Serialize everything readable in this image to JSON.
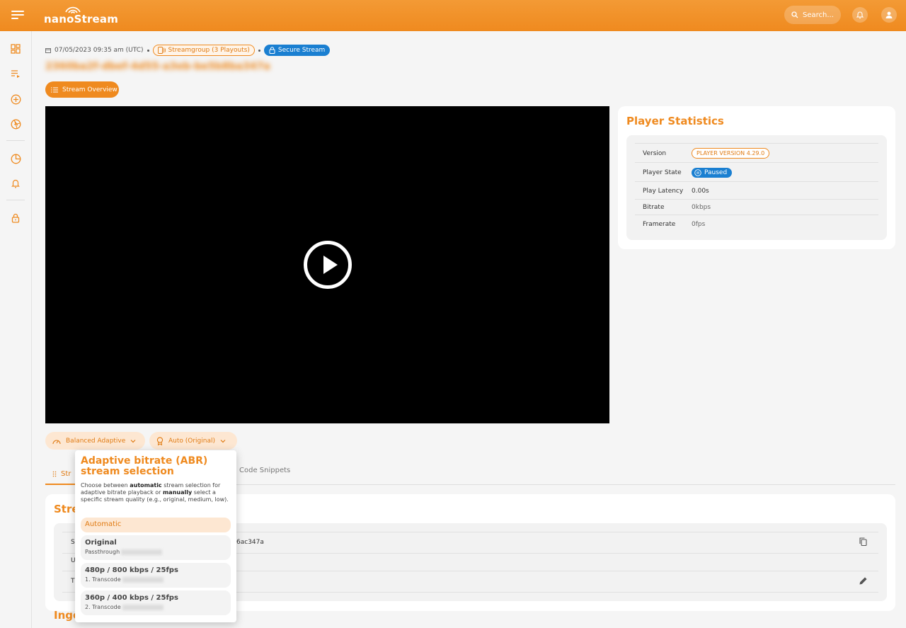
{
  "topbar": {
    "brand": "nanoStream",
    "search_label": "Search..."
  },
  "meta": {
    "date": "07/05/2023 09:35 am (UTC)",
    "streamgroup": "Streamgroup (3 Playouts)",
    "secure": "Secure Stream",
    "stream_id": "2360ba2f-dbef-4d55-a3eb-be5b8ba347a"
  },
  "overview_button": "Stream Overview",
  "player_stats": {
    "title": "Player Statistics",
    "rows": [
      {
        "key": "Version",
        "value": "PLAYER VERSION 4.29.0"
      },
      {
        "key": "Player State",
        "value": "Paused"
      },
      {
        "key": "Play Latency",
        "value": "0.00s"
      },
      {
        "key": "Bitrate",
        "value": "0kbps"
      },
      {
        "key": "Framerate",
        "value": "0fps"
      }
    ]
  },
  "selectors": {
    "mode": "Balanced Adaptive",
    "quality": "Auto (Original)"
  },
  "tabs": {
    "active": "Str",
    "code": "Code Snippets"
  },
  "info": {
    "title": "Stre",
    "row_keys": [
      "S",
      "U",
      "T"
    ],
    "stream_value": "6ac347a",
    "ingest_title": "Inge"
  },
  "popup": {
    "title": "Adaptive bitrate (ABR) stream selection",
    "desc_1": "Choose between ",
    "desc_auto": "automatic",
    "desc_2": " stream selection for adaptive bitrate playback or ",
    "desc_manual": "manually",
    "desc_3": " select a specific stream quality (e.g., original, medium, low).",
    "options": [
      {
        "label": "Automatic"
      },
      {
        "label": "Original",
        "sub": "Passthrough"
      },
      {
        "label": "480p / 800 kbps / 25fps",
        "sub": "1. Transcode"
      },
      {
        "label": "360p / 400 kbps / 25fps",
        "sub": "2. Transcode"
      }
    ]
  }
}
